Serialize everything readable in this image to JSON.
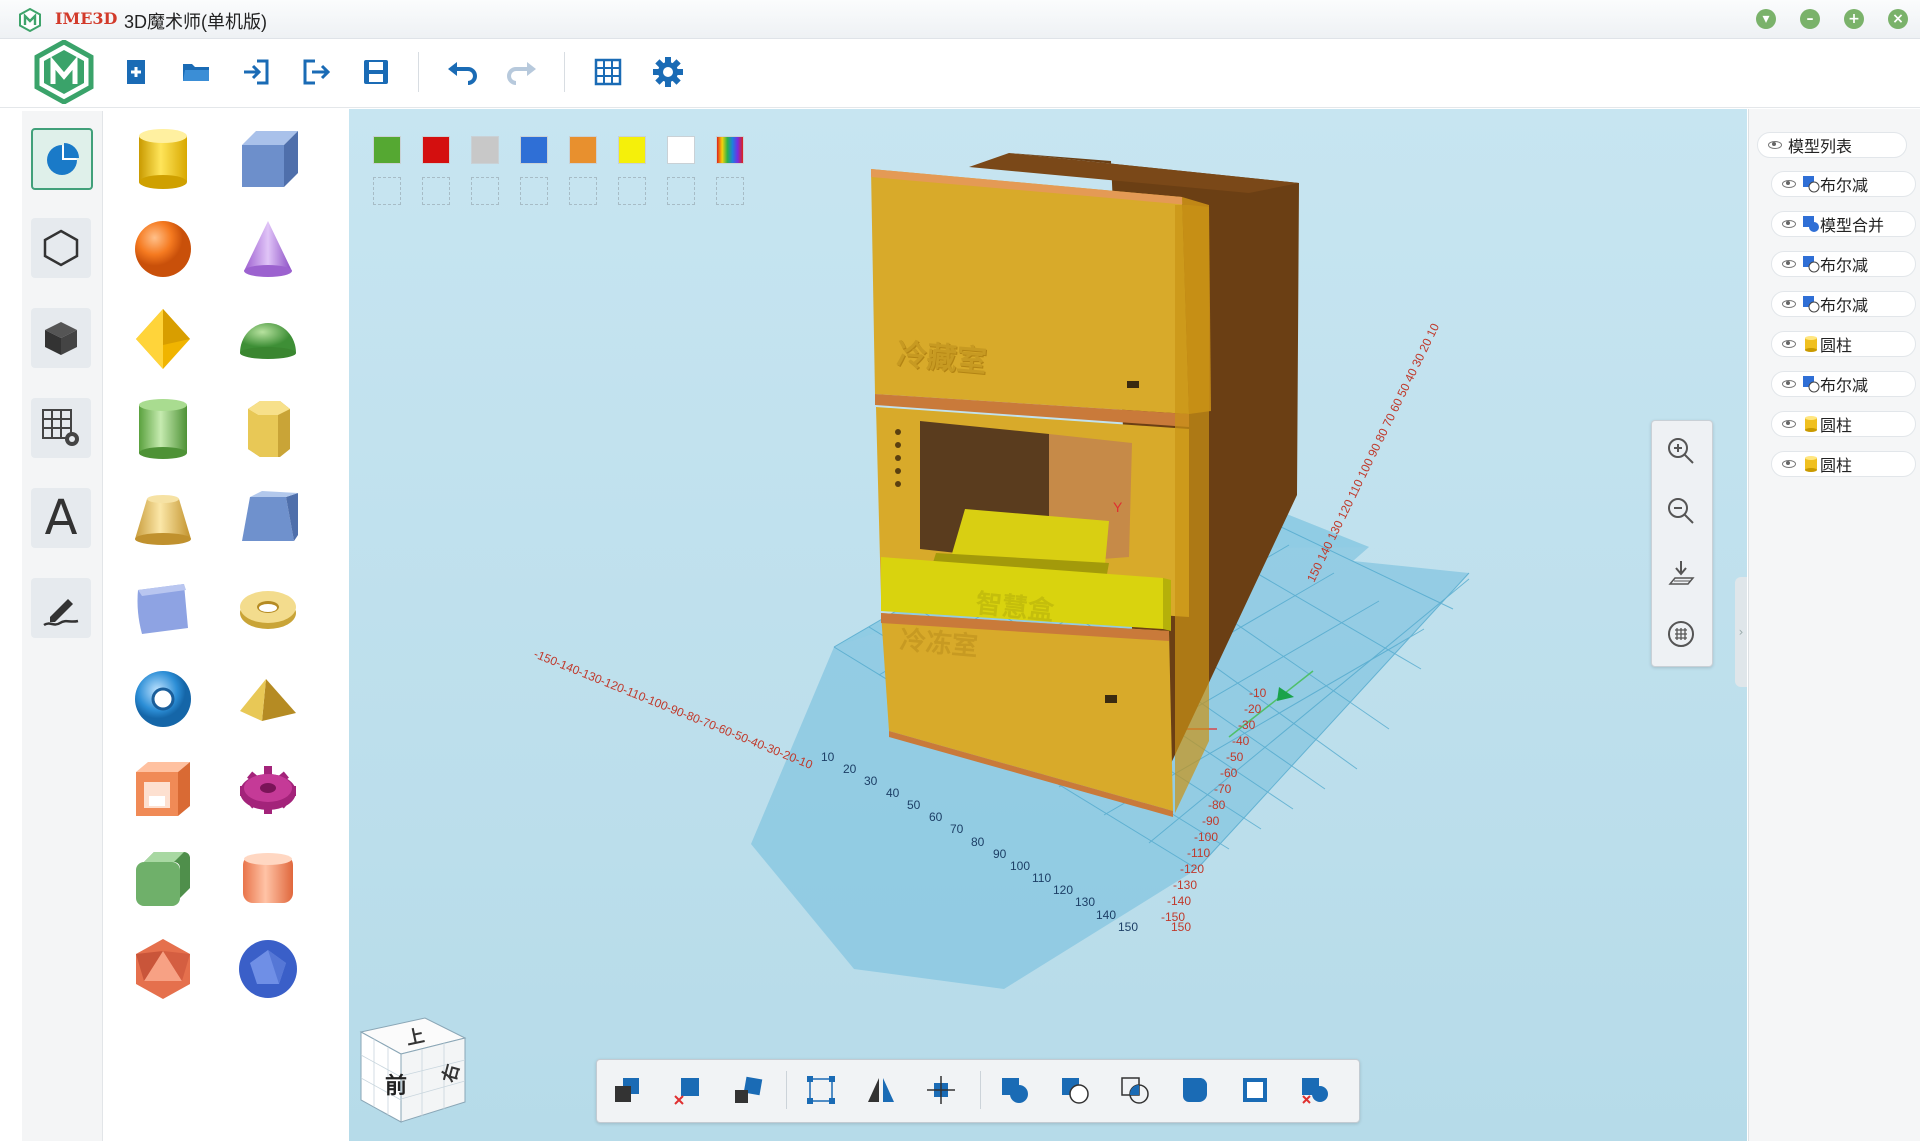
{
  "window": {
    "brand": "IME3D",
    "title": "3D魔术师(单机版)",
    "controls": [
      "dropdown-icon",
      "minimize-icon",
      "maximize-icon",
      "close-icon"
    ]
  },
  "toolbar": {
    "items": [
      "new-file-icon",
      "open-folder-icon",
      "import-icon",
      "export-icon",
      "save-icon",
      "undo-icon",
      "redo-icon",
      "grid-icon",
      "settings-icon"
    ]
  },
  "categories": [
    "basic-shapes-icon",
    "hexagon-icon",
    "cube-icon",
    "grid-settings-icon",
    "text-icon",
    "sketch-icon"
  ],
  "categories_text_label": "A",
  "shapes": [
    "cylinder",
    "box",
    "sphere",
    "cone",
    "octahedron",
    "hemisphere",
    "green-cylinder",
    "hex-prism",
    "frustum",
    "wedge",
    "cushion",
    "ring",
    "torus",
    "pyramid",
    "hollow-box",
    "gear",
    "rounded-cube",
    "rounded-cylinder",
    "icosahedron",
    "dodecahedron"
  ],
  "palette": {
    "colors": [
      "#55a832",
      "#d40f0f",
      "#c8c8c8",
      "#2f6fd6",
      "#e8902e",
      "#f5f00a",
      "#ffffff",
      "rainbow"
    ],
    "empty_slots": 8
  },
  "model_tree": {
    "root": "模型列表",
    "items": [
      {
        "label": "布尔减",
        "icon": "boolean-subtract-icon"
      },
      {
        "label": "模型合并",
        "icon": "model-merge-icon"
      },
      {
        "label": "布尔减",
        "icon": "boolean-subtract-icon"
      },
      {
        "label": "布尔减",
        "icon": "boolean-subtract-icon"
      },
      {
        "label": "圆柱",
        "icon": "cylinder-icon"
      },
      {
        "label": "布尔减",
        "icon": "boolean-subtract-icon"
      },
      {
        "label": "圆柱",
        "icon": "cylinder-icon"
      },
      {
        "label": "圆柱",
        "icon": "cylinder-icon"
      }
    ]
  },
  "viewport": {
    "model_labels": [
      "冷藏室",
      "智慧盒",
      "冷冻室"
    ],
    "axis_label_y": "Y",
    "x_ticks": [
      "10",
      "20",
      "30",
      "40",
      "50",
      "60",
      "70",
      "80",
      "90",
      "100",
      "110",
      "120",
      "130",
      "140",
      "150"
    ],
    "x_neg_ticks": "-150-140-130-120-110-100-90-80-70-60-50-40-30-20-10",
    "y_pos_ticks": "150 140 130 120 110 100 90 80 70 60 50 40 30 20 10",
    "y_neg_ticks": [
      "-10",
      "-20",
      "-30",
      "-40",
      "-50",
      "-60",
      "-70",
      "-80",
      "-90",
      "-100",
      "-110",
      "-120",
      "-130",
      "-140",
      "-150"
    ],
    "corner_label": "150"
  },
  "view_cube": {
    "top": "上",
    "front": "前",
    "right": "右"
  },
  "zoom_tools": [
    "zoom-in-icon",
    "zoom-out-icon",
    "drop-to-plane-icon",
    "fit-view-icon"
  ],
  "bottom_tools": [
    "copy-icon",
    "delete-icon",
    "move-icon",
    "bounding-box-icon",
    "mirror-icon",
    "center-icon",
    "union-icon",
    "subtract-icon",
    "intersect-icon",
    "hollow-icon",
    "shell-icon",
    "delete-boolean-icon"
  ]
}
